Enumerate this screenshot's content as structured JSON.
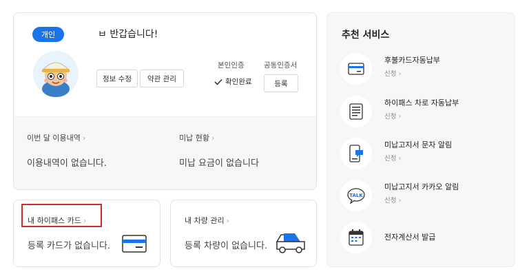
{
  "profile": {
    "badge": "개인",
    "greeting": "ㅂ 반갑습니다!",
    "edit_button": "정보 수정",
    "terms_button": "약관 관리",
    "auth_self_label": "본인인증",
    "auth_self_status": "확인완료",
    "auth_cert_label": "공동인증서",
    "register_button": "등록"
  },
  "usage": {
    "label": "이번 달 이용내역",
    "value": "이용내역이 없습니다."
  },
  "unpaid": {
    "label": "미납 현황",
    "value": "미납 요금이 없습니다"
  },
  "hipass": {
    "title": "내 하이패스 카드",
    "value": "등록 카드가 없습니다."
  },
  "vehicle": {
    "title": "내 차량 관리",
    "value": "등록 차량이 없습니다."
  },
  "recommend": {
    "title": "추천 서비스",
    "items": [
      {
        "name": "후불카드자동납부",
        "sub": "신청",
        "icon": "credit-card-icon"
      },
      {
        "name": "하이패스 차로 자동납부",
        "sub": "신청",
        "icon": "document-icon"
      },
      {
        "name": "미납고지서 문자 알림",
        "sub": "신청",
        "icon": "mobile-message-icon"
      },
      {
        "name": "미납고지서 카카오 알림",
        "sub": "신청",
        "icon": "kakao-talk-icon"
      },
      {
        "name": "전자계산서 발급",
        "sub": "",
        "icon": "calendar-icon"
      }
    ]
  },
  "chevron": "›",
  "colors": {
    "accent": "#1a73e8",
    "highlight": "#d42a2a",
    "panel_bg": "#f7f7f8"
  }
}
